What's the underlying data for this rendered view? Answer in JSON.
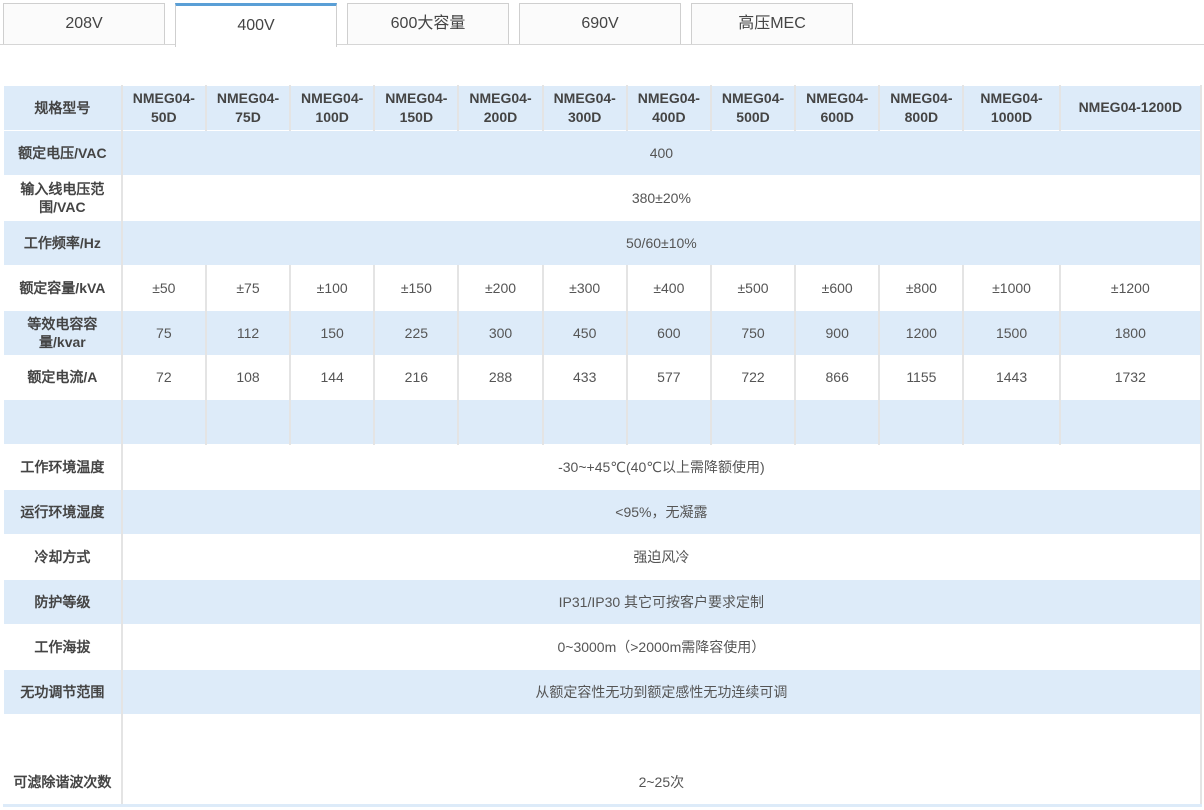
{
  "tabs": [
    {
      "label": "208V",
      "active": false
    },
    {
      "label": "400V",
      "active": true
    },
    {
      "label": "600大容量",
      "active": false
    },
    {
      "label": "690V",
      "active": false
    },
    {
      "label": "高压MEC",
      "active": false
    }
  ],
  "table": {
    "header_label": "规格型号",
    "models": [
      "NMEG04-50D",
      "NMEG04-75D",
      "NMEG04-100D",
      "NMEG04-150D",
      "NMEG04-200D",
      "NMEG04-300D",
      "NMEG04-400D",
      "NMEG04-500D",
      "NMEG04-600D",
      "NMEG04-800D",
      "NMEG04-1000D",
      "NMEG04-1200D"
    ],
    "rated_voltage": {
      "label": "额定电压/VAC",
      "value": "400"
    },
    "input_range": {
      "label": "输入线电压范围/VAC",
      "value": "380±20%"
    },
    "frequency": {
      "label": "工作频率/Hz",
      "value": "50/60±10%"
    },
    "rated_capacity": {
      "label": "额定容量/kVA",
      "values": [
        "±50",
        "±75",
        "±100",
        "±150",
        "±200",
        "±300",
        "±400",
        "±500",
        "±600",
        "±800",
        "±1000",
        "±1200"
      ]
    },
    "equiv_capacity": {
      "label": "等效电容容量/kvar",
      "values": [
        "75",
        "112",
        "150",
        "225",
        "300",
        "450",
        "600",
        "750",
        "900",
        "1200",
        "1500",
        "1800"
      ]
    },
    "rated_current": {
      "label": "额定电流/A",
      "values": [
        "72",
        "108",
        "144",
        "216",
        "288",
        "433",
        "577",
        "722",
        "866",
        "1155",
        "1443",
        "1732"
      ]
    },
    "temperature": {
      "label": "工作环境温度",
      "value": "-30~+45℃(40℃以上需降额使用)"
    },
    "humidity": {
      "label": "运行环境湿度",
      "value": "<95%，无凝露"
    },
    "cooling": {
      "label": "冷却方式",
      "value": "强迫风冷"
    },
    "protection": {
      "label": "防护等级",
      "value": "IP31/IP30 其它可按客户要求定制"
    },
    "altitude": {
      "label": "工作海拔",
      "value": "0~3000m（>2000m需降容使用）"
    },
    "regulation": {
      "label": "无功调节范围",
      "value": "从额定容性无功到额定感性无功连续可调"
    },
    "harmonics": {
      "label": "可滤除谐波次数",
      "value": "2~25次"
    }
  }
}
